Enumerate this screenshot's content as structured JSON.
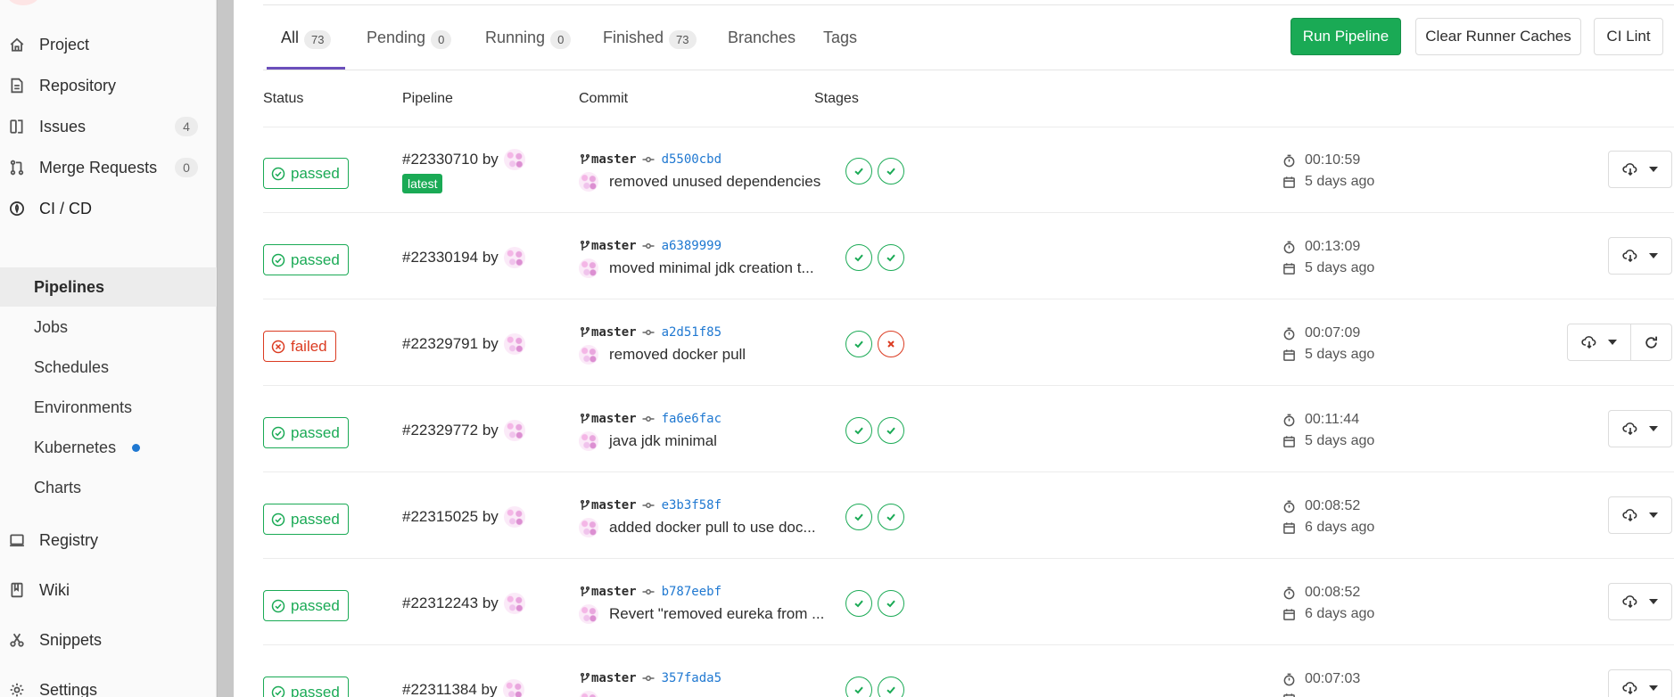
{
  "sidebar": {
    "items": [
      {
        "label": "Project",
        "icon": "home-icon"
      },
      {
        "label": "Repository",
        "icon": "file-icon"
      },
      {
        "label": "Issues",
        "icon": "issues-icon",
        "count": "4"
      },
      {
        "label": "Merge Requests",
        "icon": "merge-request-icon",
        "count": "0"
      },
      {
        "label": "CI / CD",
        "icon": "rocket-icon"
      }
    ],
    "cicd_sub": [
      {
        "label": "Pipelines",
        "active": true
      },
      {
        "label": "Jobs"
      },
      {
        "label": "Schedules"
      },
      {
        "label": "Environments"
      },
      {
        "label": "Kubernetes"
      },
      {
        "label": "Charts"
      }
    ],
    "bottom_items": [
      {
        "label": "Registry",
        "icon": "registry-icon"
      },
      {
        "label": "Wiki",
        "icon": "book-icon"
      },
      {
        "label": "Snippets",
        "icon": "scissors-icon"
      },
      {
        "label": "Settings",
        "icon": "gear-icon"
      }
    ]
  },
  "tabs": [
    {
      "label": "All",
      "count": "73",
      "active": true
    },
    {
      "label": "Pending",
      "count": "0"
    },
    {
      "label": "Running",
      "count": "0"
    },
    {
      "label": "Finished",
      "count": "73"
    },
    {
      "label": "Branches"
    },
    {
      "label": "Tags"
    }
  ],
  "actions": {
    "run_pipeline": "Run Pipeline",
    "clear_caches": "Clear Runner Caches",
    "ci_lint": "CI Lint"
  },
  "columns": {
    "status": "Status",
    "pipeline": "Pipeline",
    "commit": "Commit",
    "stages": "Stages"
  },
  "colors": {
    "success": "#1aaa55",
    "failed": "#db3b21",
    "link": "#1f78d1",
    "tab_active": "#6b4fbb"
  },
  "pipelines": [
    {
      "status": "passed",
      "id": "#22330710 by",
      "latest": "latest",
      "branch": "master",
      "sha": "d5500cbd",
      "message": "removed unused dependencies",
      "stages": [
        "success",
        "success"
      ],
      "duration": "00:10:59",
      "finished": "5 days ago"
    },
    {
      "status": "passed",
      "id": "#22330194 by",
      "branch": "master",
      "sha": "a6389999",
      "message": "moved minimal jdk creation t...",
      "stages": [
        "success",
        "success"
      ],
      "duration": "00:13:09",
      "finished": "5 days ago"
    },
    {
      "status": "failed",
      "id": "#22329791 by",
      "branch": "master",
      "sha": "a2d51f85",
      "message": "removed docker pull",
      "stages": [
        "success",
        "failed"
      ],
      "duration": "00:07:09",
      "finished": "5 days ago",
      "retry": true
    },
    {
      "status": "passed",
      "id": "#22329772 by",
      "branch": "master",
      "sha": "fa6e6fac",
      "message": "java jdk minimal",
      "stages": [
        "success",
        "success"
      ],
      "duration": "00:11:44",
      "finished": "5 days ago"
    },
    {
      "status": "passed",
      "id": "#22315025 by",
      "branch": "master",
      "sha": "e3b3f58f",
      "message": "added docker pull to use doc...",
      "stages": [
        "success",
        "success"
      ],
      "duration": "00:08:52",
      "finished": "6 days ago"
    },
    {
      "status": "passed",
      "id": "#22312243 by",
      "branch": "master",
      "sha": "b787eebf",
      "message": "Revert \"removed eureka from ...",
      "stages": [
        "success",
        "success"
      ],
      "duration": "00:08:52",
      "finished": "6 days ago"
    },
    {
      "status": "passed",
      "id": "#22311384 by",
      "branch": "master",
      "sha": "357fada5",
      "message": "",
      "stages": [
        "success",
        "success"
      ],
      "duration": "00:07:03",
      "finished": ""
    }
  ]
}
